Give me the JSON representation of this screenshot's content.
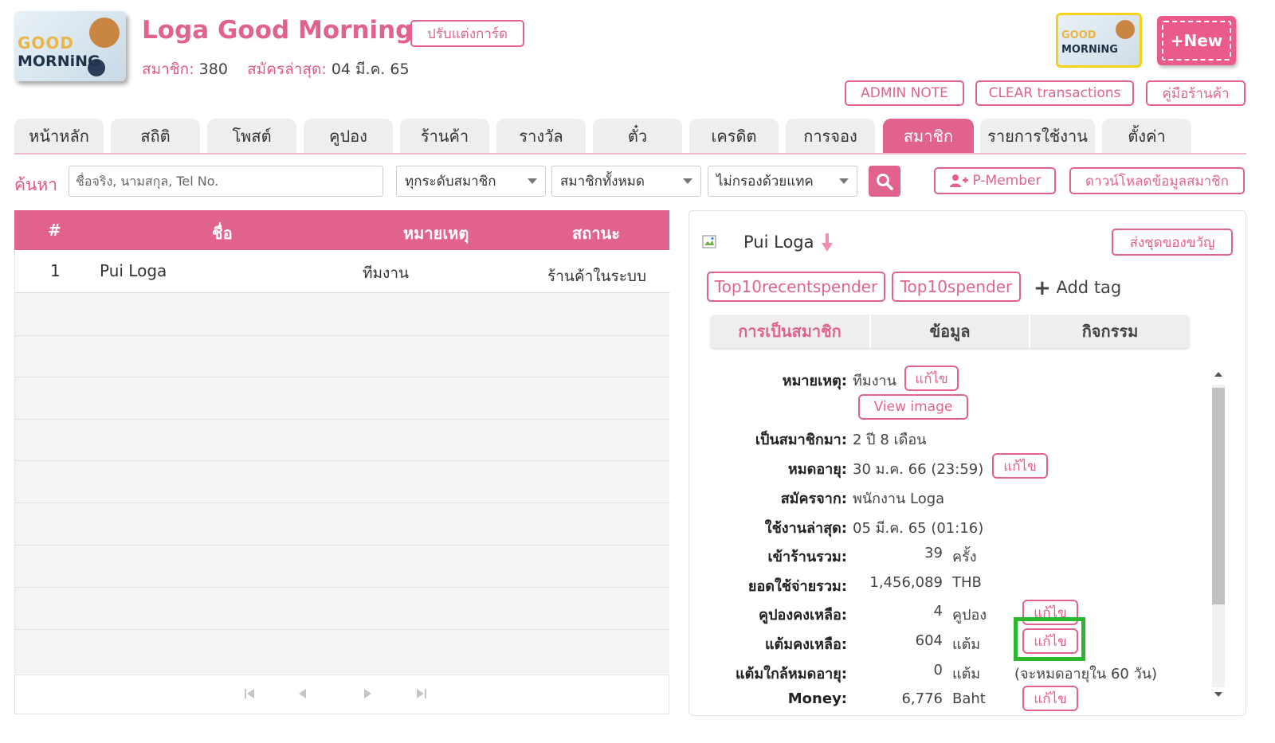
{
  "header": {
    "logo_text_top": "GOOD",
    "logo_text_bottom": "MORNiNG",
    "shop_name": "Loga Good Morning",
    "members_label": "สมาชิก:",
    "members_count": "380",
    "last_signup_label": "สมัครล่าสุด:",
    "last_signup_date": "04 มี.ค. 65",
    "customize_card": "ปรับแต่งการ์ด",
    "new_button": "+New",
    "admin_note": "ADMIN NOTE",
    "clear_transactions": "CLEAR transactions",
    "shop_manual": "คู่มือร้านค้า"
  },
  "tabs": [
    {
      "label": "หน้าหลัก"
    },
    {
      "label": "สถิติ"
    },
    {
      "label": "โพสต์"
    },
    {
      "label": "คูปอง"
    },
    {
      "label": "ร้านค้า"
    },
    {
      "label": "รางวัล"
    },
    {
      "label": "ตั๋ว"
    },
    {
      "label": "เครดิต"
    },
    {
      "label": "การจอง"
    },
    {
      "label": "สมาชิก",
      "active": true
    },
    {
      "label": "รายการใช้งาน"
    },
    {
      "label": "ตั้งค่า"
    }
  ],
  "search": {
    "label": "ค้นหา",
    "placeholder": "ชื่อจริง, นามสกุล, Tel No.",
    "level_filter": "ทุกระดับสมาชิก",
    "member_filter": "สมาชิกทั้งหมด",
    "tag_filter": "ไม่กรองด้วยแทค",
    "pmember_button": "P-Member",
    "download_button": "ดาวน์โหลดข้อมูลสมาชิก"
  },
  "table": {
    "columns": [
      "#",
      "ชื่อ",
      "หมายเหตุ",
      "สถานะ"
    ],
    "rows": [
      {
        "index": "1",
        "name": "Pui Loga",
        "note": "ทีมงาน",
        "status": "ร้านค้าในระบบ"
      }
    ]
  },
  "member": {
    "name": "Pui Loga",
    "gift_button": "ส่งชุดของขวัญ",
    "tags": [
      "Top10recentspender",
      "Top10spender"
    ],
    "add_tag": "Add tag",
    "subtabs": [
      "การเป็นสมาชิก",
      "ข้อมูล",
      "กิจกรรม"
    ],
    "note_label": "หมายเหตุ:",
    "note_value": "ทีมงาน",
    "edit": "แก้ไข",
    "view_image": "View image",
    "member_since_label": "เป็นสมาชิกมา:",
    "member_since_value": "2 ปี 8 เดือน",
    "expire_label": "หมดอายุ:",
    "expire_value": "30 ม.ค. 66 (23:59)",
    "signup_from_label": "สมัครจาก:",
    "signup_from_value": "พนักงาน Loga",
    "last_used_label": "ใช้งานล่าสุด:",
    "last_used_value": "05 มี.ค. 65 (01:16)",
    "visits_label": "เข้าร้านรวม:",
    "visits_value": "39",
    "visits_unit": "ครั้ง",
    "spend_label": "ยอดใช้จ่ายรวม:",
    "spend_value": "1,456,089",
    "spend_unit": "THB",
    "coupons_label": "คูปองคงเหลือ:",
    "coupons_value": "4",
    "coupons_unit": "คูปอง",
    "points_label": "แต้มคงเหลือ:",
    "points_value": "604",
    "points_unit": "แต้ม",
    "expiring_label": "แต้มใกล้หมดอายุ:",
    "expiring_value": "0",
    "expiring_unit": "แต้ม",
    "expiring_note": "(จะหมดอายุใน 60 วัน)",
    "money_label": "Money:",
    "money_value": "6,776",
    "money_unit": "Baht"
  },
  "colors": {
    "accent": "#e2628f",
    "highlight": "#2cb82c",
    "tab_bg": "#eeeeee"
  }
}
